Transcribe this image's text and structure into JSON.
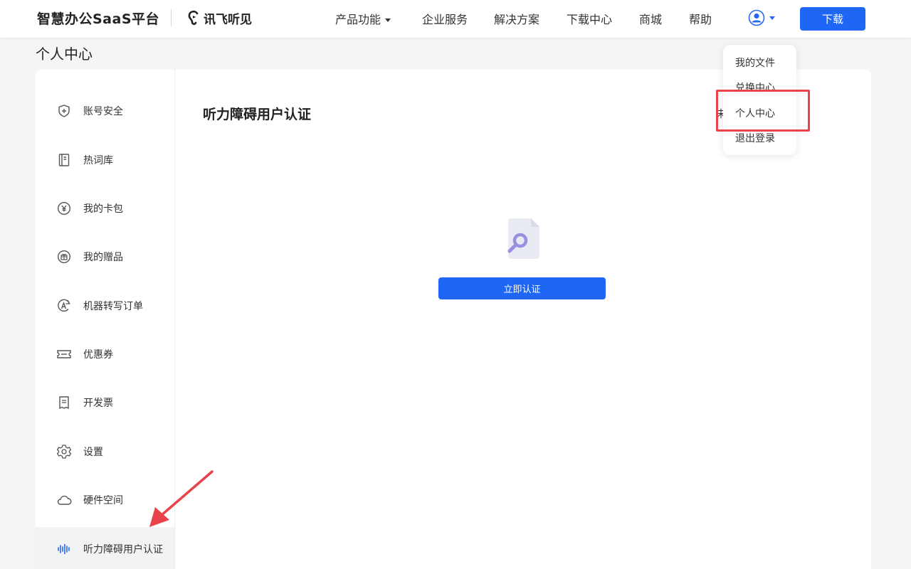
{
  "header": {
    "brand": "智慧办公SaaS平台",
    "logo_text": "讯飞听见",
    "nav": [
      {
        "label": "产品功能",
        "has_caret": true
      },
      {
        "label": "企业服务"
      },
      {
        "label": "解决方案"
      },
      {
        "label": "下载中心"
      },
      {
        "label": "商城"
      },
      {
        "label": "帮助"
      }
    ],
    "download_label": "下载"
  },
  "page": {
    "title": "个人中心"
  },
  "sidebar": {
    "items": [
      {
        "label": "账号安全",
        "icon": "shield-icon"
      },
      {
        "label": "热词库",
        "icon": "book-icon"
      },
      {
        "label": "我的卡包",
        "icon": "yen-icon"
      },
      {
        "label": "我的赠品",
        "icon": "gift-icon"
      },
      {
        "label": "机器转写订单",
        "icon": "ai-transcribe-icon"
      },
      {
        "label": "优惠券",
        "icon": "coupon-icon"
      },
      {
        "label": "开发票",
        "icon": "invoice-icon"
      },
      {
        "label": "设置",
        "icon": "gear-icon"
      },
      {
        "label": "硬件空间",
        "icon": "cloud-icon"
      },
      {
        "label": "听力障碍用户认证",
        "icon": "soundwave-icon",
        "active": true
      }
    ]
  },
  "main": {
    "title": "听力障碍用户认证",
    "verify_label": "立即认证",
    "partial_text": "未"
  },
  "user_menu": {
    "items": [
      {
        "label": "我的文件"
      },
      {
        "label": "兑换中心"
      },
      {
        "label": "个人中心"
      },
      {
        "label": "退出登录"
      }
    ]
  },
  "colors": {
    "primary": "#1e66f5",
    "highlight": "#e8434b",
    "active_bg": "#f2f3f5"
  }
}
